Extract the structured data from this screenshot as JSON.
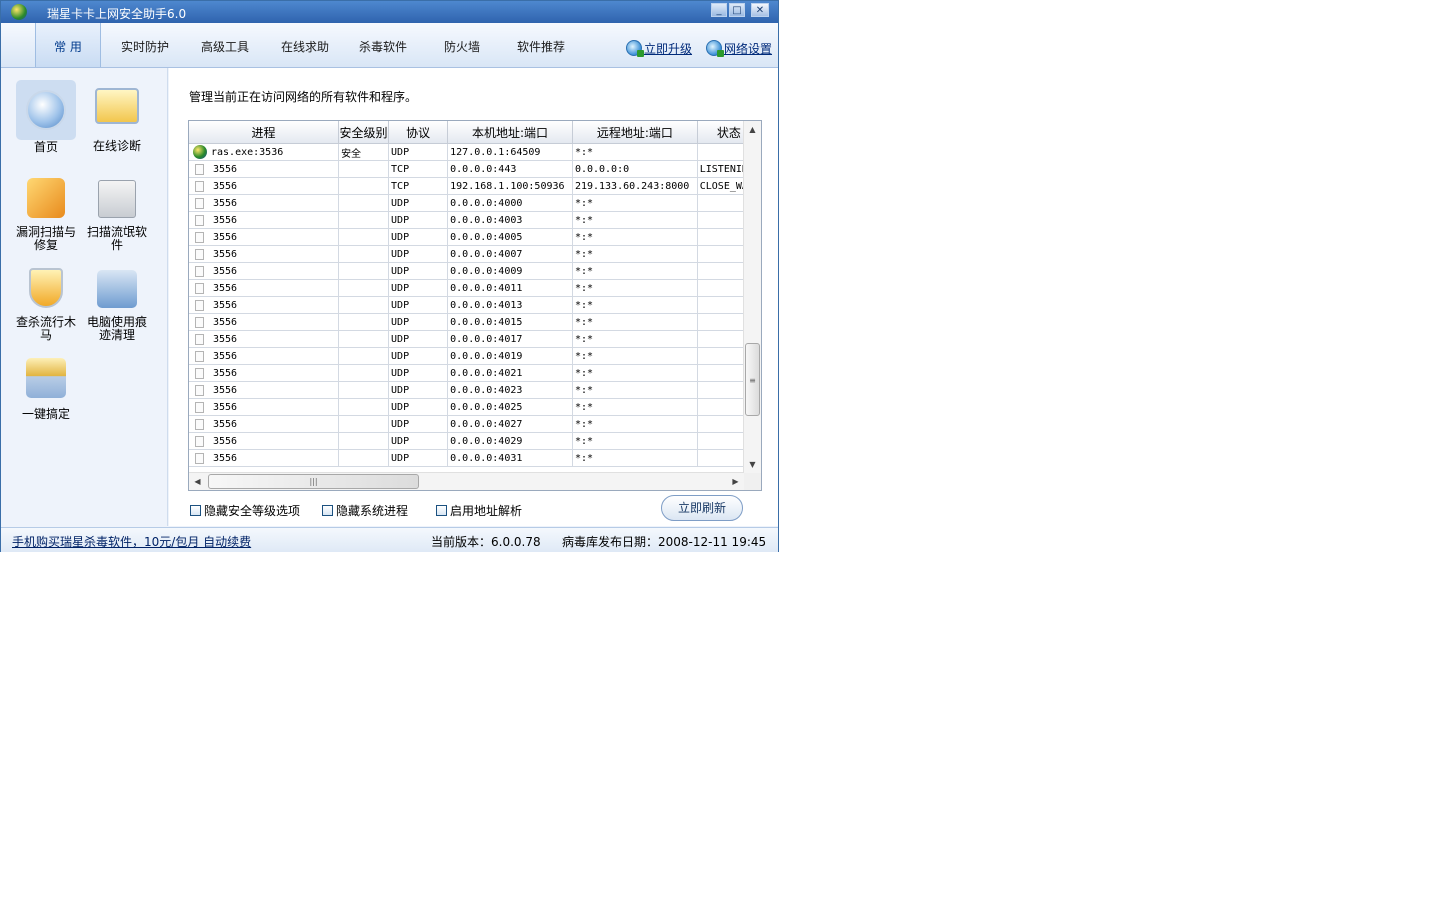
{
  "window": {
    "title": "瑞星卡卡上网安全助手6.0",
    "controls": {
      "minimize": "_",
      "maximize": "□",
      "close": "✕"
    }
  },
  "tabs": [
    {
      "label": "常 用",
      "active": true
    },
    {
      "label": "实时防护"
    },
    {
      "label": "高级工具"
    },
    {
      "label": "在线求助"
    },
    {
      "label": "杀毒软件"
    },
    {
      "label": "防火墙"
    },
    {
      "label": "软件推荐"
    }
  ],
  "top_links": {
    "upgrade": "立即升级",
    "network_settings": "网络设置"
  },
  "sidebar": [
    {
      "label": "首页",
      "icon": "home-icon",
      "active": true
    },
    {
      "label": "在线诊断",
      "icon": "diagnosis-icon"
    },
    {
      "label": "漏洞扫描与修复",
      "icon": "vulnerability-scan-icon"
    },
    {
      "label": "扫描流氓软件",
      "icon": "rogue-software-scan-icon"
    },
    {
      "label": "查杀流行木马",
      "icon": "trojan-kill-icon"
    },
    {
      "label": "电脑使用痕迹清理",
      "icon": "trace-cleanup-icon"
    },
    {
      "label": "一键搞定",
      "icon": "one-click-fix-icon"
    }
  ],
  "main": {
    "description": "管理当前正在访问网络的所有软件和程序。",
    "table": {
      "columns": [
        "进程",
        "安全级别",
        "协议",
        "本机地址:端口",
        "远程地址:端口",
        "状态"
      ],
      "rows": [
        {
          "process": "ras.exe:3536",
          "level": "安全",
          "protocol": "UDP",
          "local": "127.0.0.1:64509",
          "remote": "*:*",
          "status": ""
        },
        {
          "process": "3556",
          "level": "",
          "protocol": "TCP",
          "local": "0.0.0.0:443",
          "remote": "0.0.0.0:0",
          "status": "LISTENING"
        },
        {
          "process": "3556",
          "level": "",
          "protocol": "TCP",
          "local": "192.168.1.100:50936",
          "remote": "219.133.60.243:8000",
          "status": "CLOSE_WAIT"
        },
        {
          "process": "3556",
          "level": "",
          "protocol": "UDP",
          "local": "0.0.0.0:4000",
          "remote": "*:*",
          "status": ""
        },
        {
          "process": "3556",
          "level": "",
          "protocol": "UDP",
          "local": "0.0.0.0:4003",
          "remote": "*:*",
          "status": ""
        },
        {
          "process": "3556",
          "level": "",
          "protocol": "UDP",
          "local": "0.0.0.0:4005",
          "remote": "*:*",
          "status": ""
        },
        {
          "process": "3556",
          "level": "",
          "protocol": "UDP",
          "local": "0.0.0.0:4007",
          "remote": "*:*",
          "status": ""
        },
        {
          "process": "3556",
          "level": "",
          "protocol": "UDP",
          "local": "0.0.0.0:4009",
          "remote": "*:*",
          "status": ""
        },
        {
          "process": "3556",
          "level": "",
          "protocol": "UDP",
          "local": "0.0.0.0:4011",
          "remote": "*:*",
          "status": ""
        },
        {
          "process": "3556",
          "level": "",
          "protocol": "UDP",
          "local": "0.0.0.0:4013",
          "remote": "*:*",
          "status": ""
        },
        {
          "process": "3556",
          "level": "",
          "protocol": "UDP",
          "local": "0.0.0.0:4015",
          "remote": "*:*",
          "status": ""
        },
        {
          "process": "3556",
          "level": "",
          "protocol": "UDP",
          "local": "0.0.0.0:4017",
          "remote": "*:*",
          "status": ""
        },
        {
          "process": "3556",
          "level": "",
          "protocol": "UDP",
          "local": "0.0.0.0:4019",
          "remote": "*:*",
          "status": ""
        },
        {
          "process": "3556",
          "level": "",
          "protocol": "UDP",
          "local": "0.0.0.0:4021",
          "remote": "*:*",
          "status": ""
        },
        {
          "process": "3556",
          "level": "",
          "protocol": "UDP",
          "local": "0.0.0.0:4023",
          "remote": "*:*",
          "status": ""
        },
        {
          "process": "3556",
          "level": "",
          "protocol": "UDP",
          "local": "0.0.0.0:4025",
          "remote": "*:*",
          "status": ""
        },
        {
          "process": "3556",
          "level": "",
          "protocol": "UDP",
          "local": "0.0.0.0:4027",
          "remote": "*:*",
          "status": ""
        },
        {
          "process": "3556",
          "level": "",
          "protocol": "UDP",
          "local": "0.0.0.0:4029",
          "remote": "*:*",
          "status": ""
        },
        {
          "process": "3556",
          "level": "",
          "protocol": "UDP",
          "local": "0.0.0.0:4031",
          "remote": "*:*",
          "status": ""
        }
      ]
    },
    "options": [
      {
        "label": "隐藏安全等级选项",
        "checked": false
      },
      {
        "label": "隐藏系统进程",
        "checked": false
      },
      {
        "label": "启用地址解析",
        "checked": false
      }
    ],
    "refresh_button": "立即刷新"
  },
  "status_bar": {
    "buy_link": "手机购买瑞星杀毒软件，10元/包月 自动续费",
    "version": "当前版本：6.0.0.78",
    "virus_db_date": "病毒库发布日期：2008-12-11 19:45"
  },
  "colors": {
    "title_bar": "#2f63ae",
    "accent_text": "#002a7a",
    "panel_bg": "#eef3fb"
  }
}
